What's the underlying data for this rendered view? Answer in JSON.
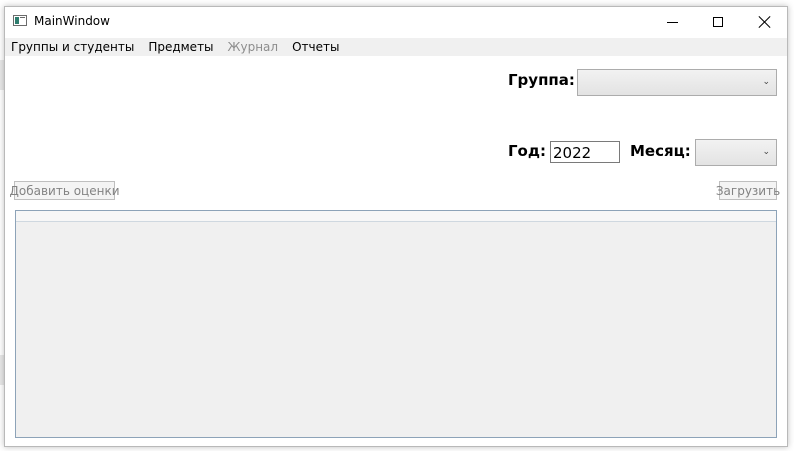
{
  "window": {
    "title": "MainWindow"
  },
  "menu": [
    {
      "label": "Группы и студенты",
      "enabled": true
    },
    {
      "label": "Предметы",
      "enabled": true
    },
    {
      "label": "Журнал",
      "enabled": false
    },
    {
      "label": "Отчеты",
      "enabled": true
    }
  ],
  "form": {
    "group_label": "Группа:",
    "group_value": "",
    "year_label": "Год:",
    "year_value": "2022",
    "month_label": "Месяц:",
    "month_value": ""
  },
  "buttons": {
    "add_grades": "Добавить оценки",
    "load": "Загрузить"
  },
  "icons": {
    "app": "app-window-icon",
    "minimize": "minimize-icon",
    "maximize": "maximize-icon",
    "close": "close-icon",
    "dropdown": "chevron-down-icon"
  }
}
